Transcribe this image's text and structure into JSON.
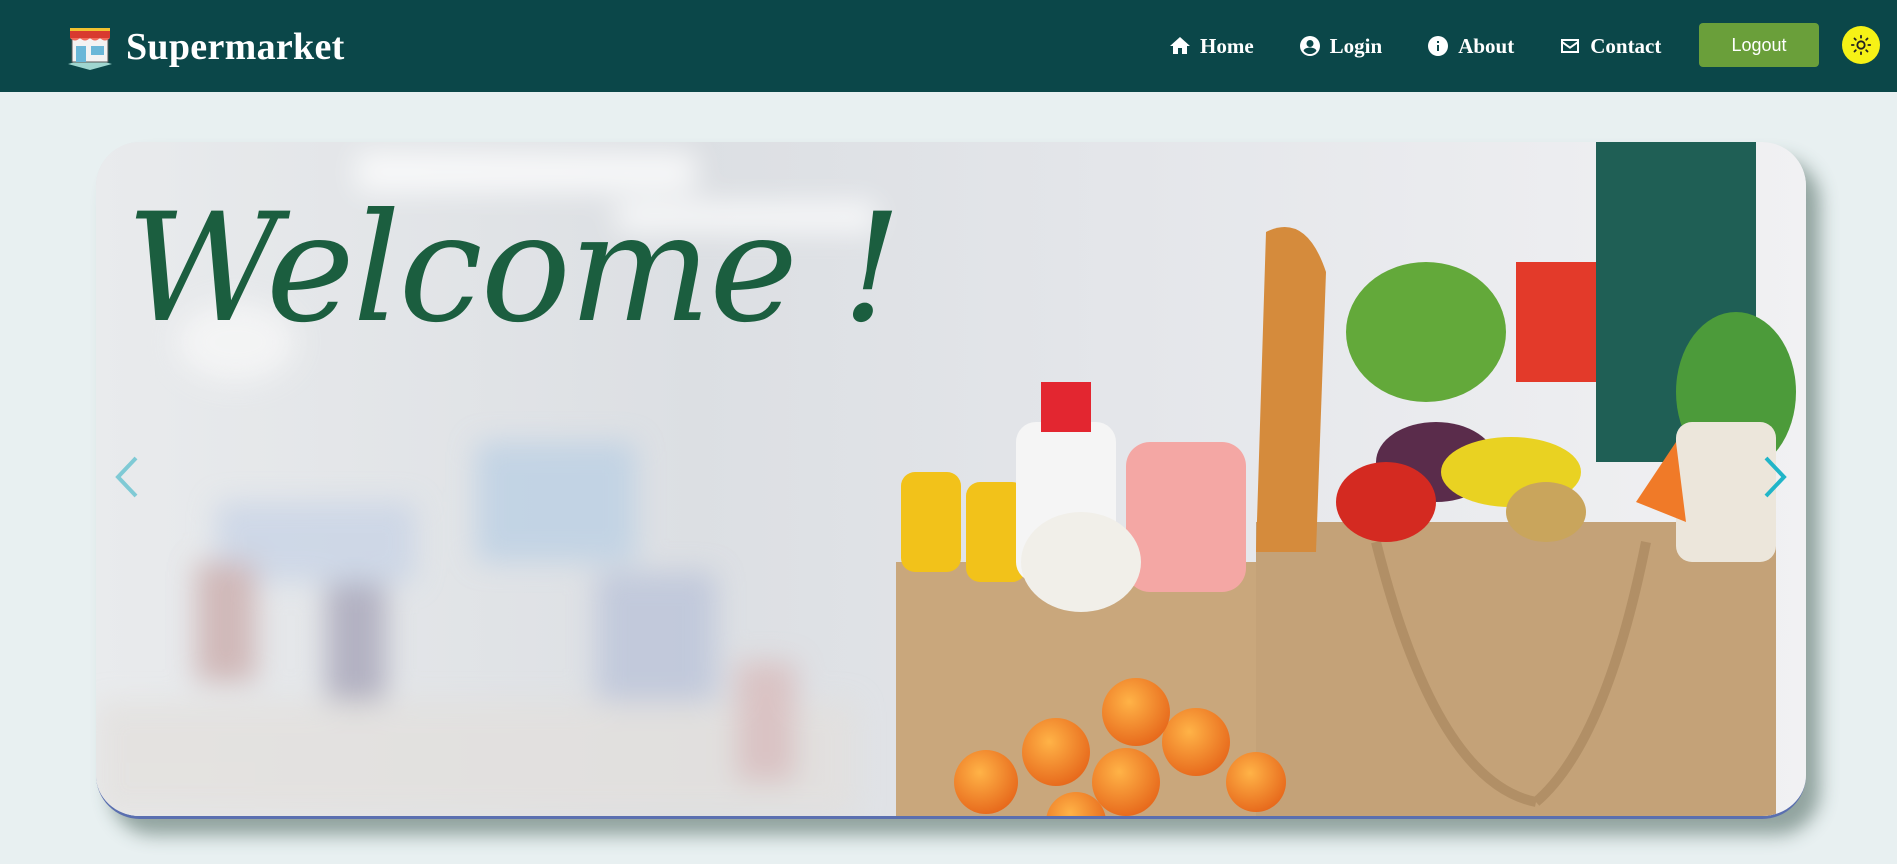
{
  "brand": {
    "name": "Supermarket",
    "logo_icon": "storefront-icon"
  },
  "nav": {
    "items": [
      {
        "label": "Home",
        "icon": "home-icon"
      },
      {
        "label": "Login",
        "icon": "user-circle-icon"
      },
      {
        "label": "About",
        "icon": "info-icon"
      },
      {
        "label": "Contact",
        "icon": "mail-icon"
      }
    ],
    "logout_label": "Logout",
    "theme_icon": "sun-icon"
  },
  "carousel": {
    "slide_text": "Welcome !",
    "prev_icon": "chevron-left-icon",
    "next_icon": "chevron-right-icon"
  },
  "colors": {
    "navbar": "#0b4749",
    "page_background": "#e8f0f1",
    "logout_button": "#6a9f3a",
    "theme_toggle": "#f6f216",
    "welcome_text": "#1b5e3f",
    "carousel_arrow": "#21b5c8"
  }
}
